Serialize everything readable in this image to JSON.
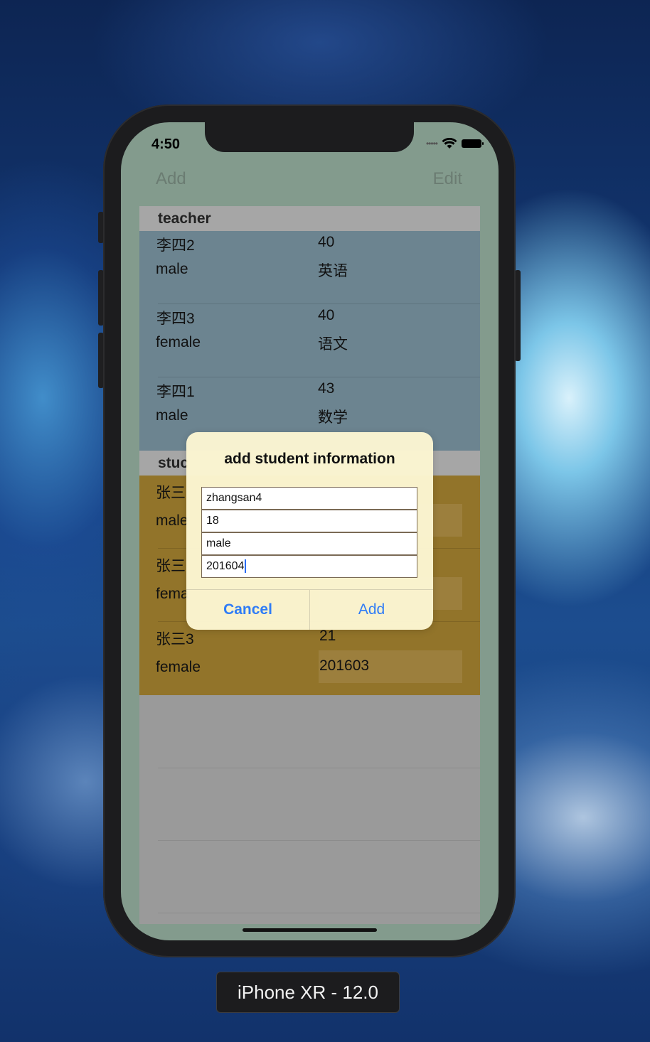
{
  "status_bar": {
    "time": "4:50",
    "dots": "•••••"
  },
  "nav": {
    "add_label": "Add",
    "edit_label": "Edit"
  },
  "sections": {
    "teacher": {
      "header": "teacher",
      "rows": [
        {
          "name": "李四2",
          "age": "40",
          "gender": "male",
          "subject": "英语"
        },
        {
          "name": "李四3",
          "age": "40",
          "gender": "female",
          "subject": "语文"
        },
        {
          "name": "李四1",
          "age": "43",
          "gender": "male",
          "subject": "数学"
        }
      ]
    },
    "student": {
      "header_visible": "stuc",
      "rows": [
        {
          "name_visible": "张三",
          "gender_visible": "male"
        },
        {
          "name_visible": "张三",
          "gender_visible": "fema"
        },
        {
          "name": "张三3",
          "age": "21",
          "gender": "female",
          "number": "201603"
        }
      ]
    }
  },
  "dialog": {
    "title": "add student information",
    "fields": {
      "name": "zhangsan4",
      "age": "18",
      "gender": "male",
      "number": "201604"
    },
    "cancel_label": "Cancel",
    "add_label": "Add"
  },
  "device_caption": "iPhone XR - 12.0",
  "colors": {
    "screen_bg": "#839b8d",
    "teacher_row": "#6c8490",
    "student_row": "#92742a",
    "dialog_bg": "#fcf6d2",
    "button_blue": "#2f7cf6"
  }
}
